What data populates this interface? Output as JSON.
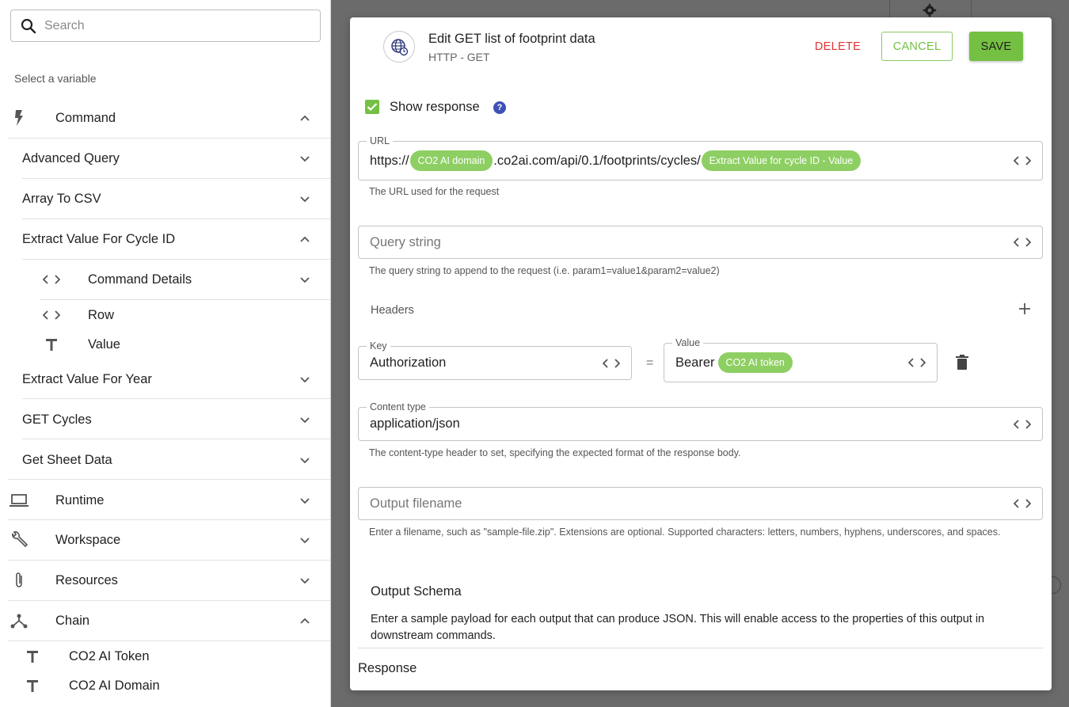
{
  "sidebar": {
    "search_placeholder": "Search",
    "select_label": "Select a variable",
    "command": "Command",
    "items": {
      "advanced_query": "Advanced Query",
      "array_to_csv": "Array To CSV",
      "extract_cycle": "Extract Value For Cycle ID",
      "command_details": "Command Details",
      "row": "Row",
      "value": "Value",
      "extract_year": "Extract Value For Year",
      "get_cycles": "GET Cycles",
      "get_sheet": "Get Sheet Data"
    },
    "runtime": "Runtime",
    "workspace": "Workspace",
    "resources": "Resources",
    "chain": "Chain",
    "chain_items": {
      "token": "CO2 AI Token",
      "domain": "CO2 AI Domain"
    }
  },
  "modal": {
    "title": "Edit GET list of footprint data",
    "subtitle": "HTTP - GET",
    "delete_label": "DELETE",
    "cancel_label": "CANCEL",
    "save_label": "SAVE",
    "show_response_label": "Show response",
    "help": "?",
    "url": {
      "label": "URL",
      "prefix": "https://",
      "chip1": "CO2 AI domain",
      "middle": ".co2ai.com/api/0.1/footprints/cycles/",
      "chip2": "Extract Value for cycle ID - Value",
      "hint": "The URL used for the request"
    },
    "query": {
      "placeholder": "Query string",
      "hint": "The query string to append to the request (i.e. param1=value1&param2=value2)"
    },
    "headers": {
      "label": "Headers",
      "key_label": "Key",
      "key_value": "Authorization",
      "eq": "=",
      "value_label": "Value",
      "value_prefix": "Bearer",
      "value_chip": "CO2 AI token"
    },
    "content_type": {
      "label": "Content type",
      "value": "application/json",
      "hint": "The content-type header to set, specifying the expected format of the response body."
    },
    "output_filename": {
      "placeholder": "Output filename",
      "hint": "Enter a filename, such as \"sample-file.zip\". Extensions are optional. Supported characters: letters, numbers, hyphens, underscores, and spaces."
    },
    "output_schema": {
      "title": "Output Schema",
      "desc": "Enter a sample payload for each output that can produce JSON. This will enable access to the properties of this output in downstream commands."
    },
    "response_label": "Response"
  },
  "colors": {
    "accent": "#74c043",
    "chip": "#8ecf63",
    "danger": "#e23232",
    "help": "#3f51b5"
  }
}
